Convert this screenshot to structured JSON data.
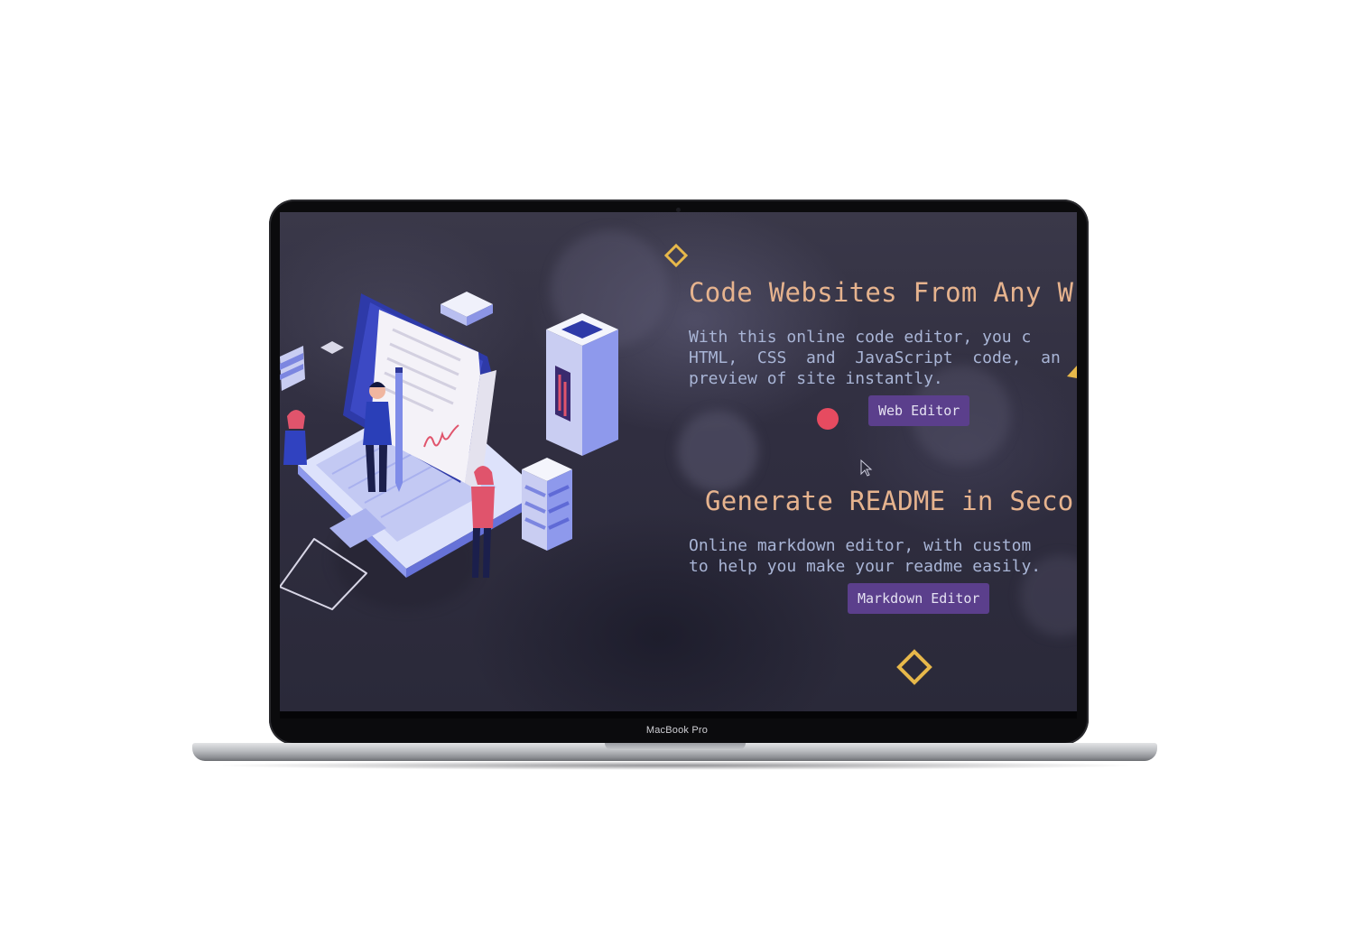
{
  "device": {
    "brand_label": "MacBook Pro"
  },
  "sections": [
    {
      "title": "Code Websites From Any W",
      "description": "With this online code editor, you c\nHTML,  CSS  and  JavaScript  code,  an\npreview of site instantly.",
      "button_label": "Web Editor"
    },
    {
      "title": "Generate README in Seco",
      "description": "Online markdown editor, with custom\nto help you make your readme easily.",
      "button_label": "Markdown Editor"
    }
  ],
  "colors": {
    "background": "#302e40",
    "title": "#e6b38e",
    "description": "#a9b5d6",
    "button": "#5b3f8c",
    "accent_diamond": "#e7b84a",
    "accent_dot": "#e64b60"
  },
  "icons": {
    "illustration": "isometric-laptop-illustration",
    "decorations": [
      "diamond-outline-icon",
      "diamond-outline-icon",
      "triangle-icon",
      "circle-dot-icon"
    ],
    "cursor": "mouse-pointer-icon"
  }
}
